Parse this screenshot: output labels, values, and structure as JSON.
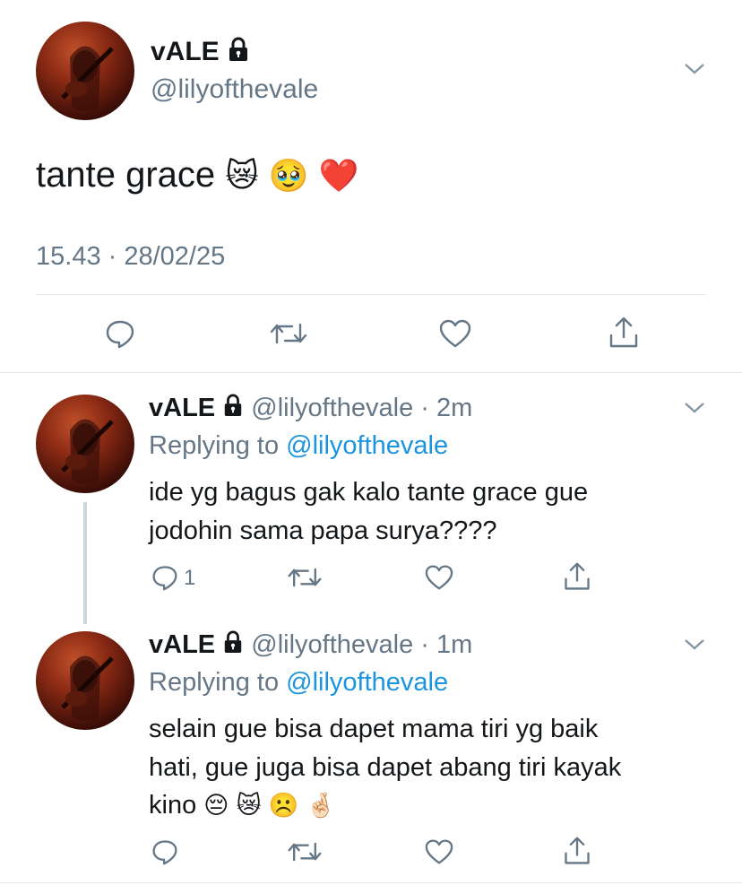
{
  "main_tweet": {
    "display_name": "vALE",
    "handle": "@lilyofthevale",
    "text": "tante grace",
    "emojis": [
      "😿",
      "🥹",
      "❤️"
    ],
    "timestamp": "15.43 · 28/02/25"
  },
  "replies": [
    {
      "display_name": "vALE",
      "handle": "@lilyofthevale",
      "time": "· 2m",
      "replying_prefix": "Replying to",
      "replying_to": "@lilyofthevale",
      "text_line1": "ide yg bagus gak kalo tante grace gue",
      "text_line2": "jodohin sama papa surya????",
      "reply_count": "1"
    },
    {
      "display_name": "vALE",
      "handle": "@lilyofthevale",
      "time": "· 1m",
      "replying_prefix": "Replying to",
      "replying_to": "@lilyofthevale",
      "text_line1": "selain gue bisa dapet mama tiri yg baik",
      "text_line2": "hati, gue juga bisa dapet abang tiri kayak",
      "text_line3": "kino",
      "emojis": [
        "😔",
        "😿",
        "☹️",
        "🤞🏻"
      ]
    }
  ],
  "icons": [
    "lock-icon",
    "chevron-down-icon",
    "reply-icon",
    "retweet-icon",
    "like-icon",
    "share-icon"
  ],
  "colors": {
    "link": "#1b95e0",
    "secondary_text": "#657786",
    "divider": "#e1e8ed"
  }
}
